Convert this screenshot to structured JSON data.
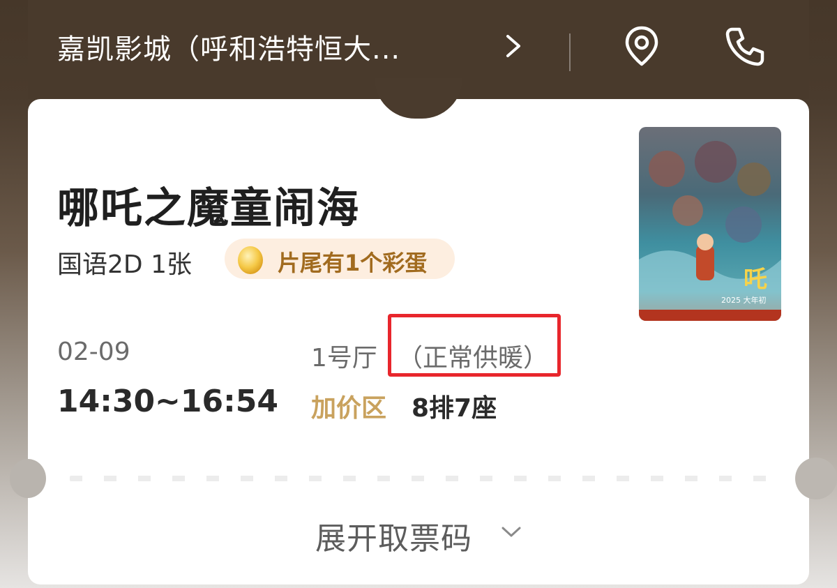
{
  "header": {
    "cinema_name": "嘉凯影城（呼和浩特恒大..."
  },
  "movie": {
    "title": "哪吒之魔童闹海",
    "language_format": "国语2D",
    "ticket_count": "1张",
    "easter_egg_badge": "片尾有1个彩蛋",
    "poster_year_text": "2025 大年初"
  },
  "showtime": {
    "date": "02-09",
    "time_range": "14:30~16:54",
    "hall": "1号厅",
    "hall_note": "（正常供暖）",
    "zone": "加价区",
    "seat": "8排7座"
  },
  "footer": {
    "expand_label": "展开取票码"
  },
  "colors": {
    "header_bg": "#493a2c",
    "zone_gold": "#c9a25e",
    "badge_bg": "#fdeee0",
    "badge_text": "#a16b1f",
    "highlight_red": "#e8262c"
  },
  "icons": [
    "chevron-right-icon",
    "location-pin-icon",
    "phone-icon",
    "egg-icon",
    "chevron-down-icon"
  ]
}
